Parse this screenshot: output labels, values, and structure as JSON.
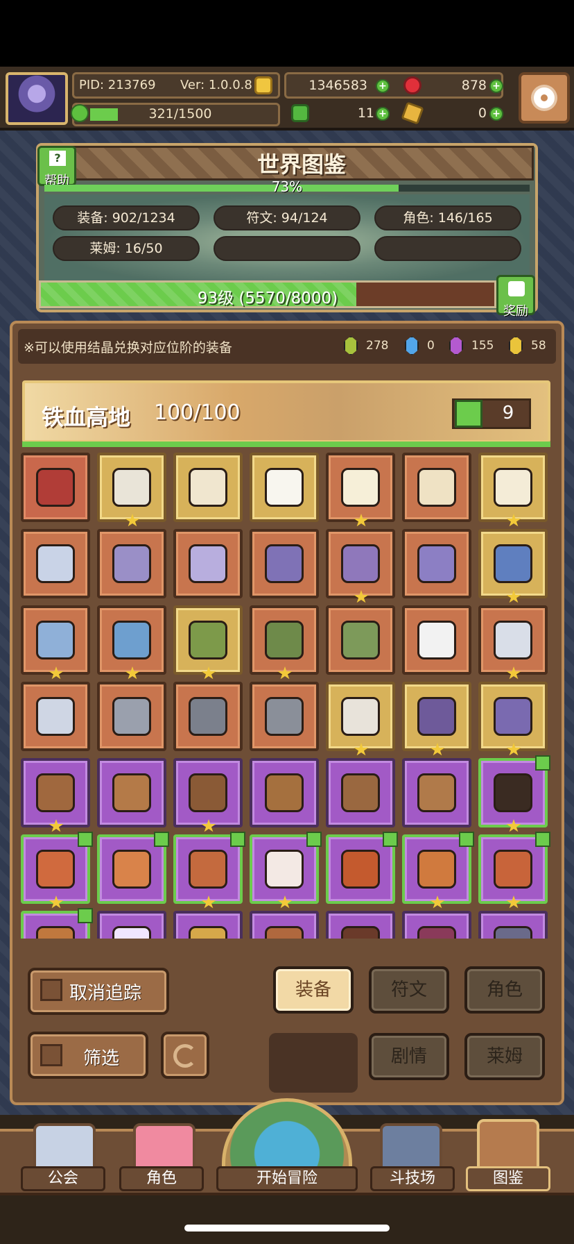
{
  "header": {
    "pid": "PID: 213769",
    "version": "Ver: 1.0.0.8",
    "exp": "321/1500",
    "gold": "1346583",
    "ruby": "878",
    "clover": "11",
    "key": "0",
    "plus": "+"
  },
  "codex": {
    "title": "世界图鉴",
    "help_label": "帮助",
    "percent": "73%",
    "percent_value": 0.73,
    "stats": {
      "equip": "装备: 902/1234",
      "rune": "符文: 94/124",
      "role": "角色: 146/165",
      "slime": "莱姆: 16/50"
    },
    "level": "93级 (5570/8000)",
    "level_value": 0.696,
    "reward_label": "奖励"
  },
  "tip": {
    "text": "※可以使用结晶兑换对应位阶的装备",
    "gems": {
      "green": "278",
      "blue": "0",
      "purple": "155",
      "gold": "58"
    }
  },
  "zone": {
    "name": "铁血高地",
    "progress": "100/100",
    "likes": "9"
  },
  "items": [
    {
      "color": "red",
      "art": "#b13d37",
      "star": false,
      "tag": false
    },
    {
      "color": "gold",
      "art": "#e9e4d8",
      "star": true,
      "tag": false
    },
    {
      "color": "gold",
      "art": "#f0e6cf",
      "star": false,
      "tag": false
    },
    {
      "color": "gold",
      "art": "#f8f6ef",
      "star": false,
      "tag": false
    },
    {
      "color": "orange",
      "art": "#f6efd8",
      "star": true,
      "tag": false
    },
    {
      "color": "orange",
      "art": "#efe2c4",
      "star": false,
      "tag": false
    },
    {
      "color": "gold",
      "art": "#f4ecd7",
      "star": true,
      "tag": false
    },
    {
      "color": "orange",
      "art": "#c9d3e7",
      "star": false,
      "tag": false
    },
    {
      "color": "orange",
      "art": "#9a8fc7",
      "star": false,
      "tag": false
    },
    {
      "color": "orange",
      "art": "#b8aede",
      "star": false,
      "tag": false
    },
    {
      "color": "orange",
      "art": "#7f72b6",
      "star": false,
      "tag": false
    },
    {
      "color": "orange",
      "art": "#8f78bb",
      "star": true,
      "tag": false
    },
    {
      "color": "orange",
      "art": "#8c7fc4",
      "star": false,
      "tag": false
    },
    {
      "color": "gold",
      "art": "#5f7fbf",
      "star": true,
      "tag": false
    },
    {
      "color": "orange",
      "art": "#8fb0d8",
      "star": true,
      "tag": false
    },
    {
      "color": "orange",
      "art": "#6e9fcf",
      "star": true,
      "tag": false
    },
    {
      "color": "gold",
      "art": "#7d9a4a",
      "star": true,
      "tag": false
    },
    {
      "color": "orange",
      "art": "#6e8a4a",
      "star": true,
      "tag": false
    },
    {
      "color": "orange",
      "art": "#7d9a5a",
      "star": false,
      "tag": false
    },
    {
      "color": "orange",
      "art": "#f2f2f2",
      "star": false,
      "tag": false
    },
    {
      "color": "orange",
      "art": "#d9dee8",
      "star": true,
      "tag": false
    },
    {
      "color": "orange",
      "art": "#cfd6e4",
      "star": false,
      "tag": false
    },
    {
      "color": "orange",
      "art": "#9aa0ad",
      "star": false,
      "tag": false
    },
    {
      "color": "orange",
      "art": "#7b808c",
      "star": false,
      "tag": false
    },
    {
      "color": "orange",
      "art": "#8a8f99",
      "star": false,
      "tag": false
    },
    {
      "color": "gold",
      "art": "#e8e3da",
      "star": true,
      "tag": false
    },
    {
      "color": "gold",
      "art": "#6e5a9a",
      "star": true,
      "tag": false
    },
    {
      "color": "gold",
      "art": "#7a6ab0",
      "star": true,
      "tag": false
    },
    {
      "color": "purple",
      "art": "#a0683e",
      "star": true,
      "tag": false
    },
    {
      "color": "purple",
      "art": "#b47a48",
      "star": false,
      "tag": false
    },
    {
      "color": "purple",
      "art": "#8a5a36",
      "star": true,
      "tag": false
    },
    {
      "color": "purple",
      "art": "#a5703e",
      "star": false,
      "tag": false
    },
    {
      "color": "purple",
      "art": "#9a6840",
      "star": false,
      "tag": false
    },
    {
      "color": "purple",
      "art": "#b07a4a",
      "star": false,
      "tag": false
    },
    {
      "color": "purple",
      "art": "#3a2b22",
      "star": true,
      "tag": true
    },
    {
      "color": "purple",
      "art": "#d06a3e",
      "star": true,
      "tag": true
    },
    {
      "color": "purple",
      "art": "#d9834a",
      "star": false,
      "tag": true
    },
    {
      "color": "purple",
      "art": "#c46a3e",
      "star": true,
      "tag": true
    },
    {
      "color": "purple",
      "art": "#f3e9e4",
      "star": true,
      "tag": true
    },
    {
      "color": "purple",
      "art": "#c45a2e",
      "star": false,
      "tag": true
    },
    {
      "color": "purple",
      "art": "#d07a3e",
      "star": true,
      "tag": true
    },
    {
      "color": "purple",
      "art": "#c8643a",
      "star": true,
      "tag": true
    },
    {
      "color": "purple",
      "art": "#c0783e",
      "star": false,
      "tag": true
    },
    {
      "color": "purple",
      "art": "#f0e6ff",
      "star": false,
      "tag": false
    },
    {
      "color": "purple",
      "art": "#d6a84a",
      "star": false,
      "tag": false
    },
    {
      "color": "purple",
      "art": "#b0683e",
      "star": false,
      "tag": false
    },
    {
      "color": "purple",
      "art": "#6a3a2a",
      "star": false,
      "tag": false
    },
    {
      "color": "purple",
      "art": "#8a3a5a",
      "star": false,
      "tag": false
    },
    {
      "color": "purple",
      "art": "#6a6a8a",
      "star": false,
      "tag": false
    }
  ],
  "controls": {
    "untrack": "取消追踪",
    "filter": "筛选"
  },
  "tabs": {
    "equip": "装备",
    "rune": "符文",
    "role": "角色",
    "story": "剧情",
    "slime": "莱姆",
    "active": "equip"
  },
  "nav": {
    "guild": "公会",
    "role": "角色",
    "adventure": "开始冒险",
    "arena": "斗技场",
    "codex": "图鉴"
  }
}
